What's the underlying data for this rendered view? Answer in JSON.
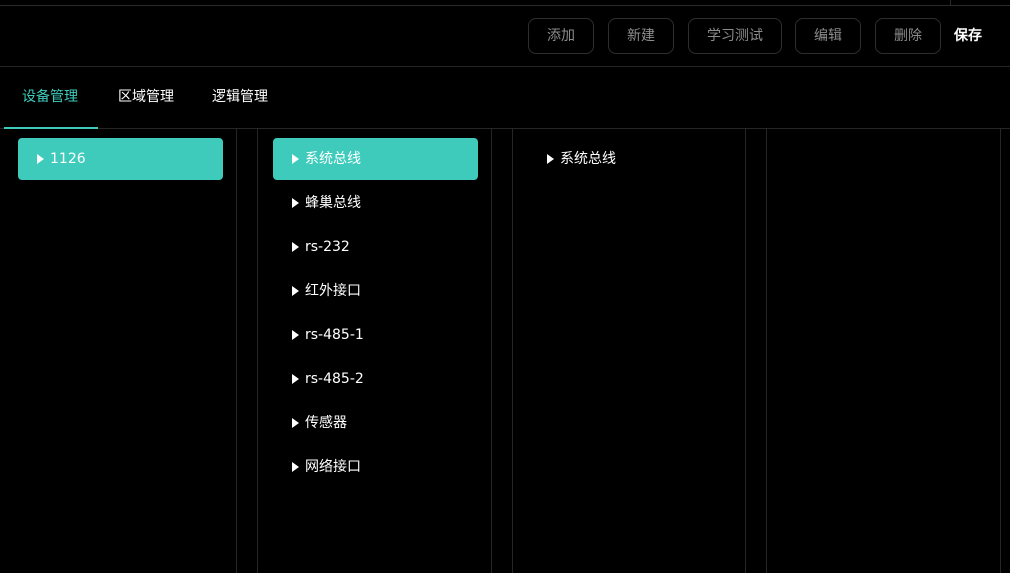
{
  "toolbar": {
    "buttons": [
      {
        "label": "添加"
      },
      {
        "label": "新建"
      },
      {
        "label": "学习测试"
      },
      {
        "label": "编辑"
      },
      {
        "label": "删除"
      }
    ],
    "save_label": "保存"
  },
  "tabs": [
    {
      "label": "设备管理",
      "active": true
    },
    {
      "label": "区域管理",
      "active": false
    },
    {
      "label": "逻辑管理",
      "active": false
    }
  ],
  "columns": {
    "col1": [
      {
        "label": "1126",
        "selected": true
      }
    ],
    "col2": [
      {
        "label": "系统总线",
        "selected": true
      },
      {
        "label": "蜂巢总线",
        "selected": false
      },
      {
        "label": "rs-232",
        "selected": false
      },
      {
        "label": "红外接口",
        "selected": false
      },
      {
        "label": "rs-485-1",
        "selected": false
      },
      {
        "label": "rs-485-2",
        "selected": false
      },
      {
        "label": "传感器",
        "selected": false
      },
      {
        "label": "网络接口",
        "selected": false
      }
    ],
    "col3": [
      {
        "label": "系统总线",
        "selected": false
      }
    ]
  },
  "colors": {
    "accent": "#3ecbbc",
    "background": "#000000",
    "border": "#262626",
    "muted_text": "#8c8c8c"
  }
}
